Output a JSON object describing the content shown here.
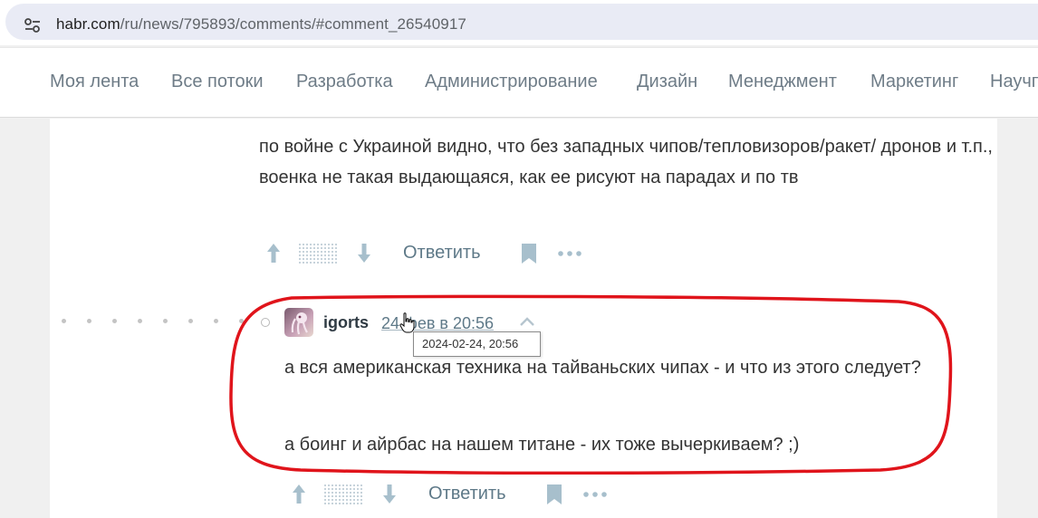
{
  "browser": {
    "url_host": "habr.com",
    "url_path": "/ru/news/795893/comments/#comment_26540917",
    "site_info_icon": "tune-icon"
  },
  "nav": {
    "items": [
      "Моя лента",
      "Все потоки",
      "Разработка",
      "Администрирование",
      "Дизайн",
      "Менеджмент",
      "Маркетинг",
      "Научпоп"
    ]
  },
  "comment_parent": {
    "text": "по войне с Украиной видно, что без западных чипов/тепловизоров/ракет/ дронов и т.п., военка не такая выдающаяся, как ее рисуют на парадах и по тв",
    "actions": {
      "reply_label": "Ответить"
    }
  },
  "comment_reply": {
    "username": "igorts",
    "date": "24 фев в 20:56",
    "tooltip": "2024-02-24, 20:56",
    "paragraphs": [
      "а вся американская техника на тайваньских чипах - и что из этого следует?",
      "а боинг и айрбас на нашем титане - их тоже вычеркиваем? ;)"
    ],
    "actions": {
      "reply_label": "Ответить"
    }
  },
  "colors": {
    "nav_text": "#6e7c87",
    "link": "#5e7988",
    "annotation": "#e0141b",
    "icon": "#a7bfcc"
  }
}
